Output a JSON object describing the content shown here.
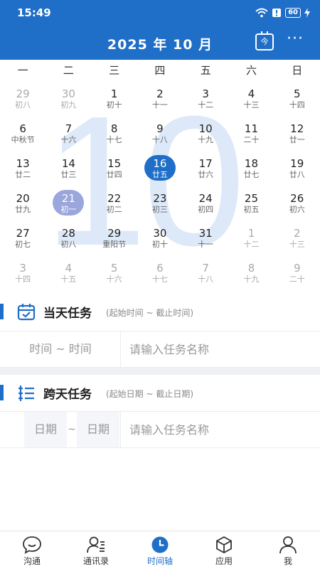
{
  "status": {
    "time": "15:49",
    "battery": "60"
  },
  "header": {
    "title": "2025 年 10 月",
    "today_glyph": "今",
    "more_glyph": "···"
  },
  "weekdays": [
    "一",
    "二",
    "三",
    "四",
    "五",
    "六",
    "日"
  ],
  "watermark": "10",
  "calendar": [
    [
      {
        "n": "29",
        "l": "初八",
        "o": true
      },
      {
        "n": "30",
        "l": "初九",
        "o": true
      },
      {
        "n": "1",
        "l": "初十"
      },
      {
        "n": "2",
        "l": "十一"
      },
      {
        "n": "3",
        "l": "十二"
      },
      {
        "n": "4",
        "l": "十三"
      },
      {
        "n": "5",
        "l": "十四"
      }
    ],
    [
      {
        "n": "6",
        "l": "中秋节"
      },
      {
        "n": "7",
        "l": "十六"
      },
      {
        "n": "8",
        "l": "十七"
      },
      {
        "n": "9",
        "l": "十八"
      },
      {
        "n": "10",
        "l": "十九"
      },
      {
        "n": "11",
        "l": "二十"
      },
      {
        "n": "12",
        "l": "廿一"
      }
    ],
    [
      {
        "n": "13",
        "l": "廿二"
      },
      {
        "n": "14",
        "l": "廿三"
      },
      {
        "n": "15",
        "l": "廿四"
      },
      {
        "n": "16",
        "l": "廿五",
        "sel": true
      },
      {
        "n": "17",
        "l": "廿六"
      },
      {
        "n": "18",
        "l": "廿七"
      },
      {
        "n": "19",
        "l": "廿八"
      }
    ],
    [
      {
        "n": "20",
        "l": "廿九"
      },
      {
        "n": "21",
        "l": "初一",
        "today": true
      },
      {
        "n": "22",
        "l": "初二"
      },
      {
        "n": "23",
        "l": "初三"
      },
      {
        "n": "24",
        "l": "初四"
      },
      {
        "n": "25",
        "l": "初五"
      },
      {
        "n": "26",
        "l": "初六"
      }
    ],
    [
      {
        "n": "27",
        "l": "初七"
      },
      {
        "n": "28",
        "l": "初八"
      },
      {
        "n": "29",
        "l": "重阳节"
      },
      {
        "n": "30",
        "l": "初十"
      },
      {
        "n": "31",
        "l": "十一"
      },
      {
        "n": "1",
        "l": "十二",
        "o": true
      },
      {
        "n": "2",
        "l": "十三",
        "o": true
      }
    ],
    [
      {
        "n": "3",
        "l": "十四",
        "o": true
      },
      {
        "n": "4",
        "l": "十五",
        "o": true
      },
      {
        "n": "5",
        "l": "十六",
        "o": true
      },
      {
        "n": "6",
        "l": "十七",
        "o": true
      },
      {
        "n": "7",
        "l": "十八",
        "o": true
      },
      {
        "n": "8",
        "l": "十九",
        "o": true
      },
      {
        "n": "9",
        "l": "二十",
        "o": true
      }
    ]
  ],
  "day_task": {
    "title": "当天任务",
    "hint": "(起始时间 ~ 截止时间)",
    "range": "时间 ~ 时间",
    "placeholder": "请输入任务名称"
  },
  "cross_task": {
    "title": "跨天任务",
    "hint": "(起始日期 ~ 截止日期)",
    "start": "日期",
    "sep": "~",
    "end": "日期",
    "placeholder": "请输入任务名称"
  },
  "tabs": [
    {
      "label": "沟通",
      "icon": "chat-icon"
    },
    {
      "label": "通讯录",
      "icon": "contacts-icon"
    },
    {
      "label": "时间轴",
      "icon": "clock-icon",
      "active": true
    },
    {
      "label": "应用",
      "icon": "apps-cube-icon"
    },
    {
      "label": "我",
      "icon": "profile-icon"
    }
  ],
  "colors": {
    "primary": "#1f6ec7",
    "today": "#9aa6dc",
    "watermark": "#dde9f8"
  }
}
